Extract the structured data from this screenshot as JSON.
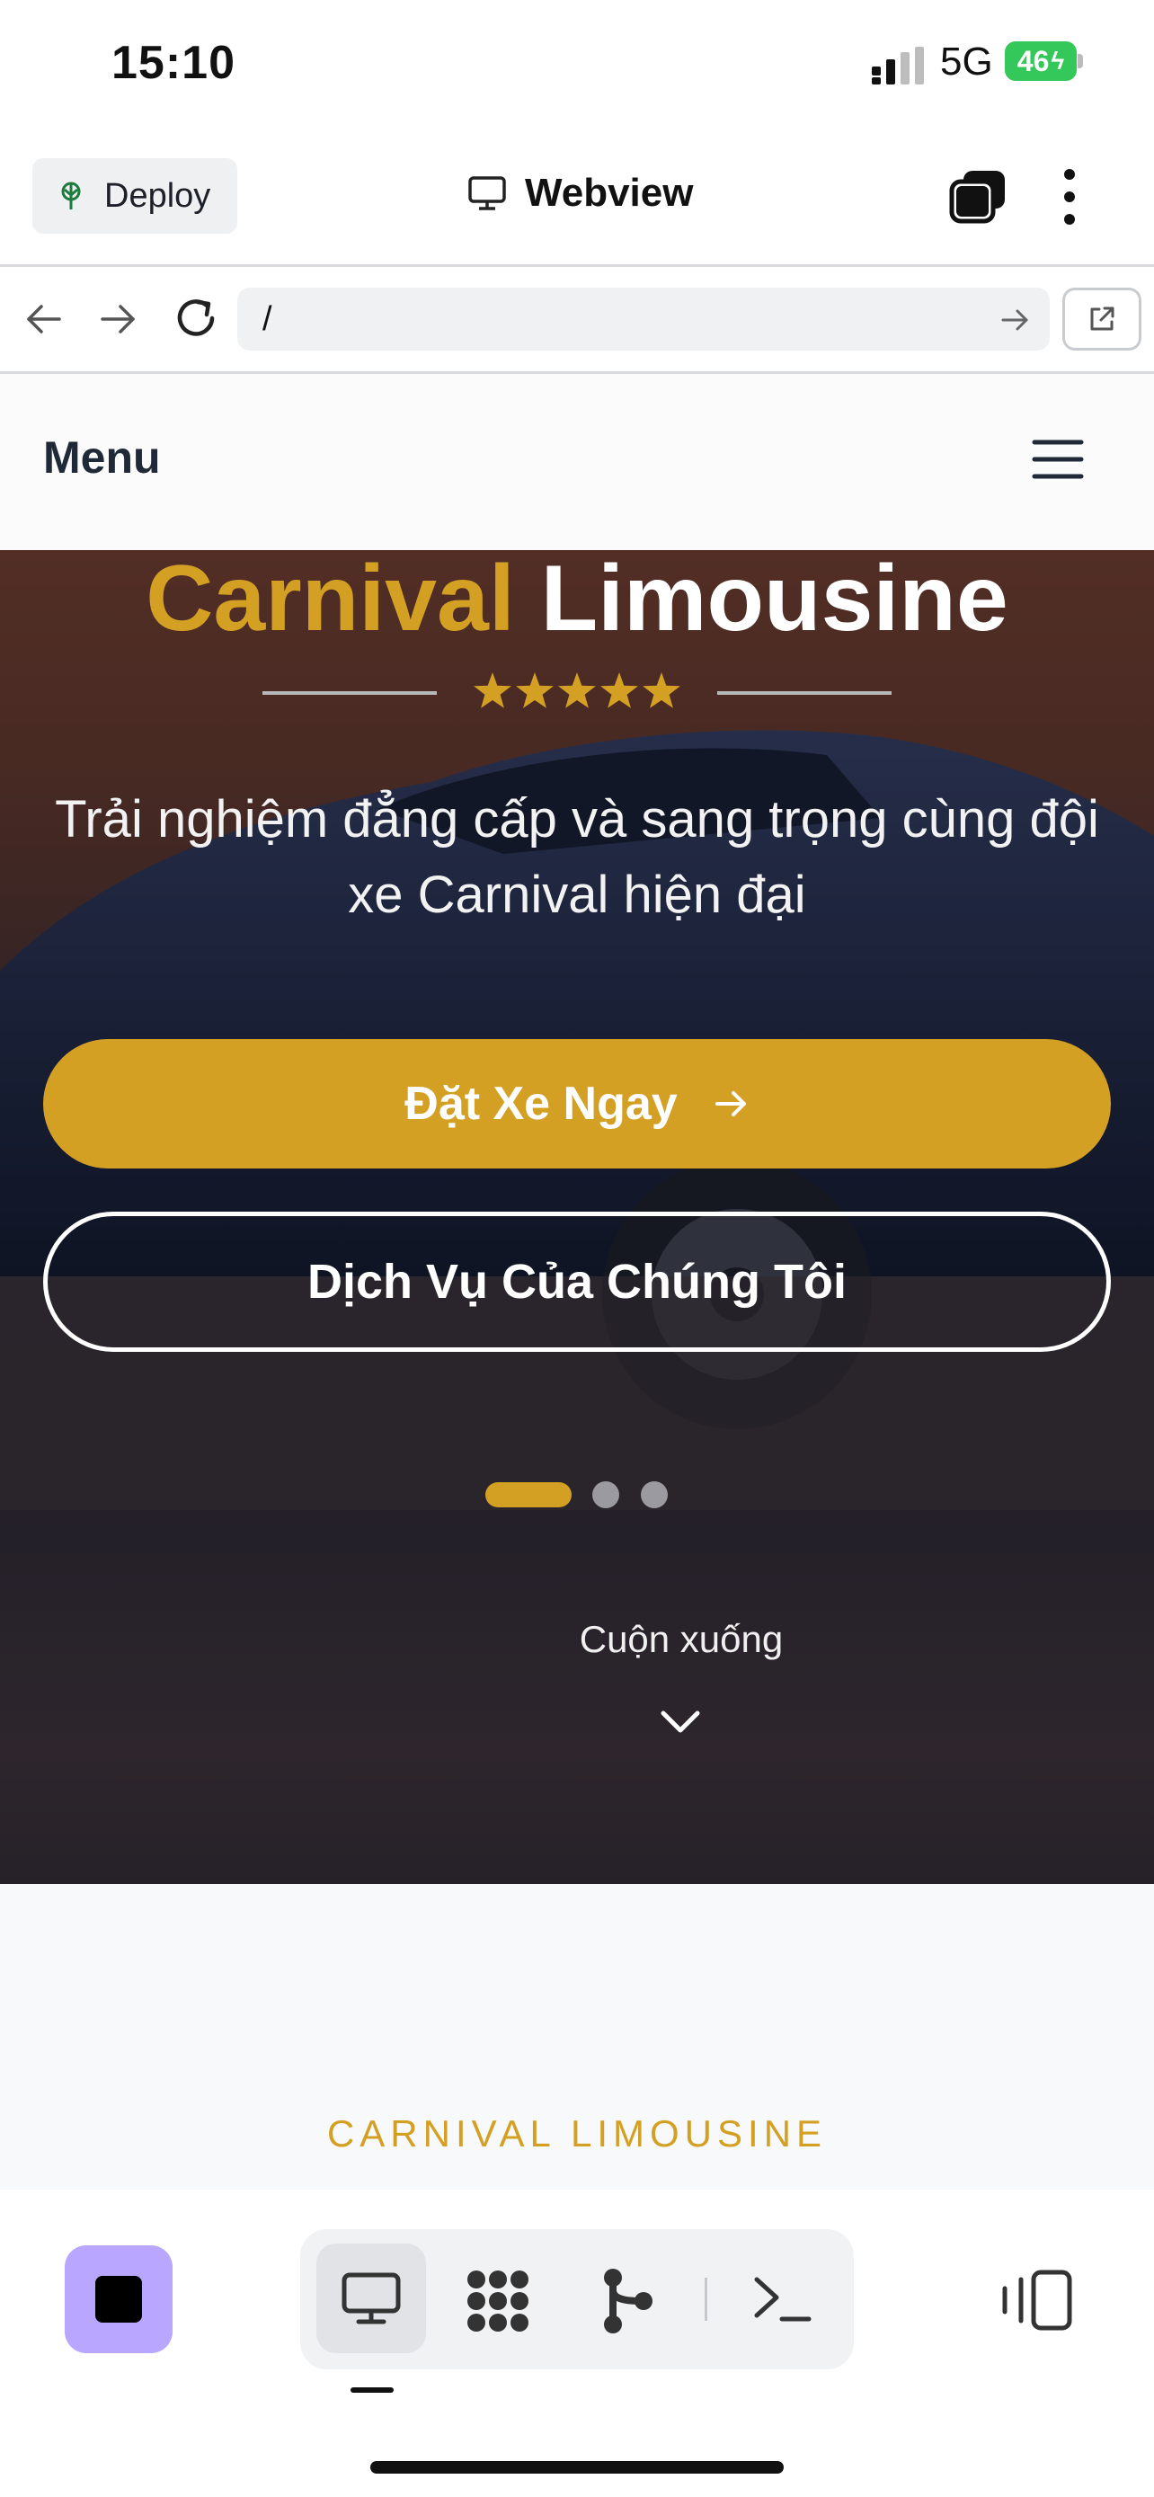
{
  "status_bar": {
    "time": "15:10",
    "network": "5G",
    "battery": "46"
  },
  "topbar": {
    "deploy_label": "Deploy",
    "title": "Webview"
  },
  "urlbar": {
    "url": "/"
  },
  "site": {
    "menu_label": "Menu",
    "hero": {
      "title_part1": "Carnival",
      "title_part2": "Limousine",
      "rating_stars": 5,
      "subtitle": "Trải nghiệm đẳng cấp và sang trọng cùng đội xe Carnival hiện đại",
      "primary_cta": "Đặt Xe Ngay",
      "secondary_cta": "Dịch Vụ Của Chúng Tôi",
      "carousel": {
        "slides": 3,
        "active_index": 0
      },
      "scroll_hint": "Cuộn xuống"
    },
    "section": {
      "kicker": "CARNIVAL LIMOUSINE"
    }
  },
  "colors": {
    "accent_gold": "#d4a023",
    "stop_button": "#b9a6ff",
    "battery_green": "#34c759"
  },
  "icons": [
    "deploy-icon",
    "monitor-icon",
    "tabs-icon",
    "more-icon",
    "back-arrow-icon",
    "forward-arrow-icon",
    "reload-icon",
    "go-arrow-icon",
    "external-link-icon",
    "hamburger-icon",
    "star-icon",
    "arrow-right-icon",
    "chevron-down-icon",
    "stop-icon",
    "webview-icon",
    "grid-icon",
    "git-branch-icon",
    "shell-icon",
    "layout-toggle-icon"
  ]
}
